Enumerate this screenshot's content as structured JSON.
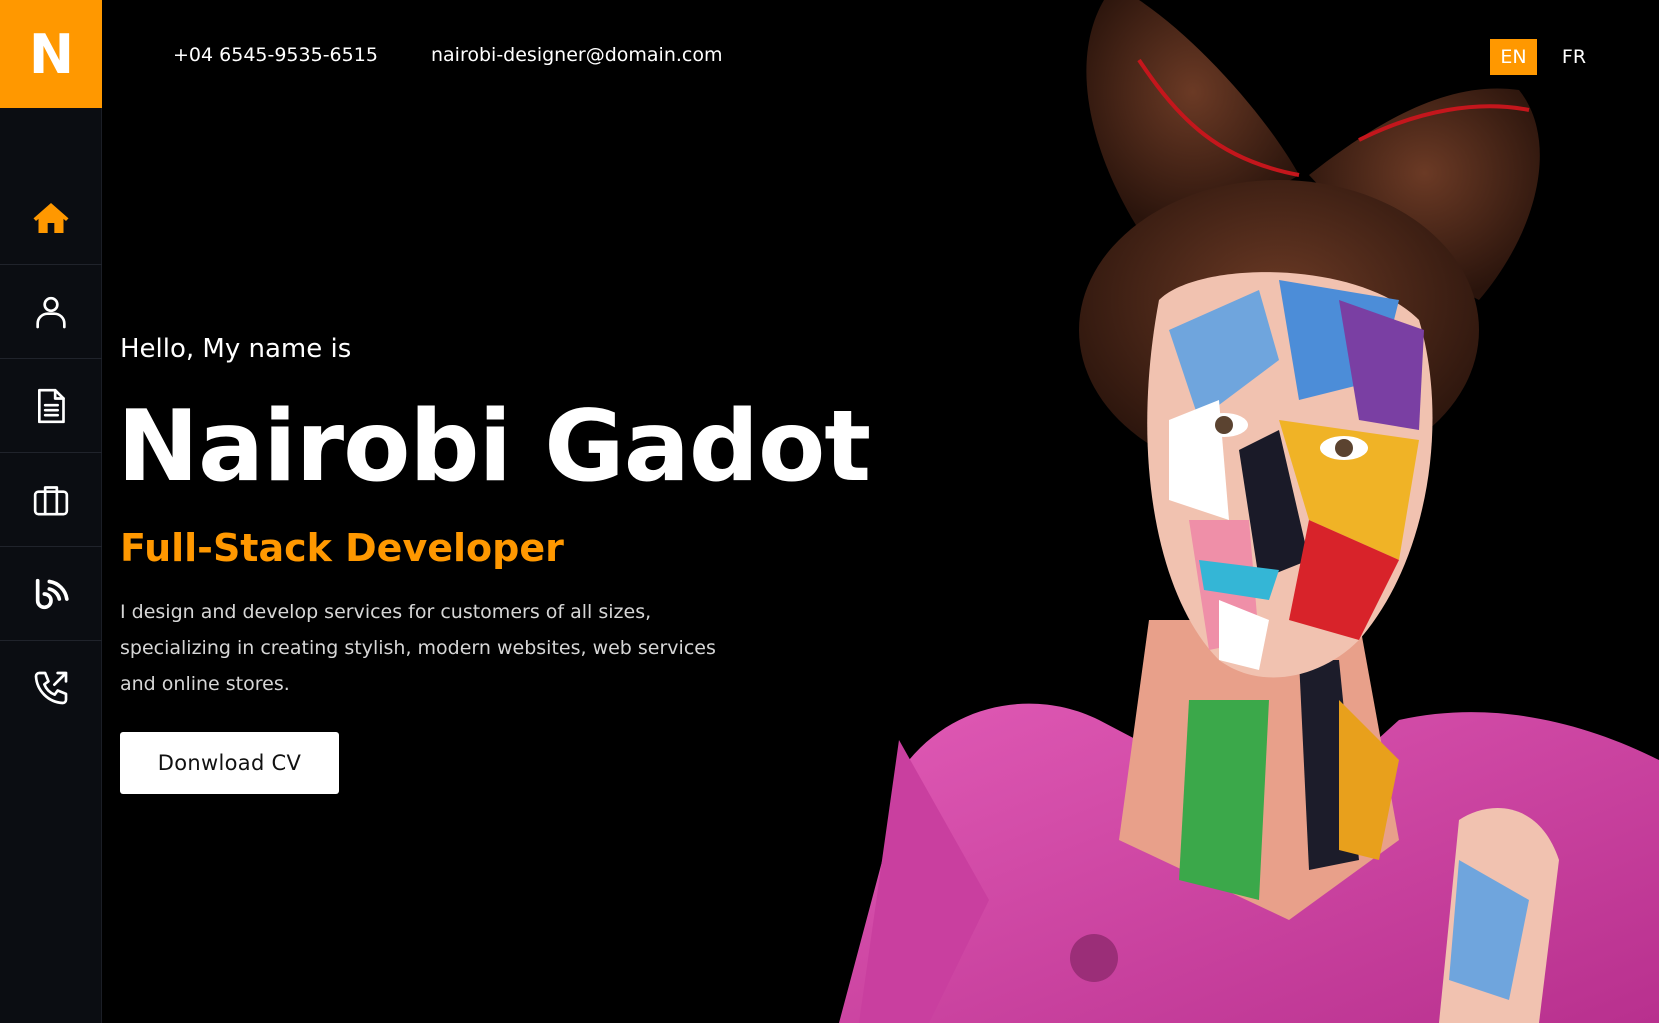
{
  "brand": {
    "logo_letter": "N",
    "accent_color": "#ff9800"
  },
  "contact": {
    "phone": "+04 6545-9535-6515",
    "email": "nairobi-designer@domain.com"
  },
  "languages": [
    {
      "code": "EN",
      "active": true
    },
    {
      "code": "FR",
      "active": false
    }
  ],
  "sidebar": {
    "items": [
      {
        "icon": "home-icon",
        "active": true
      },
      {
        "icon": "user-icon",
        "active": false
      },
      {
        "icon": "document-icon",
        "active": false
      },
      {
        "icon": "briefcase-icon",
        "active": false
      },
      {
        "icon": "blog-feed-icon",
        "active": false
      },
      {
        "icon": "phone-outgoing-icon",
        "active": false
      }
    ]
  },
  "hero": {
    "greeting": "Hello, My name is",
    "name": "Nairobi Gadot",
    "role": "Full-Stack Developer",
    "description": "I design and develop services for customers of all sizes, specializing in creating stylish, modern websites, web services and online stores.",
    "cta_label": "Donwload CV"
  }
}
